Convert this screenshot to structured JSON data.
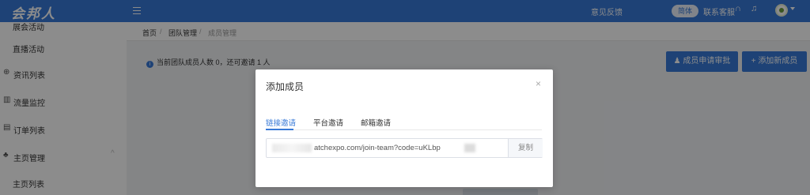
{
  "header": {
    "logo": "会邦人",
    "feedback": "意见反馈",
    "lang": "简体",
    "support": "联系客服"
  },
  "sidebar": {
    "items": [
      {
        "label": "展会活动",
        "icon": ""
      },
      {
        "label": "直播活动",
        "icon": ""
      },
      {
        "label": "资讯列表",
        "icon": "globe-icon"
      },
      {
        "label": "流量监控",
        "icon": "bar-chart-icon"
      },
      {
        "label": "订单列表",
        "icon": "clipboard-icon"
      },
      {
        "label": "主页管理",
        "icon": "sitemap-icon"
      },
      {
        "label": "主页列表",
        "icon": ""
      }
    ]
  },
  "breadcrumb": {
    "home": "首页",
    "sep": "/",
    "team": "团队管理",
    "current": "成员管理"
  },
  "notice": "当前团队成员人数 0，还可邀请 1 人",
  "buttons": {
    "approve": "成员申请审批",
    "add": "添加新成员"
  },
  "modal": {
    "title": "添加成员",
    "tabs": [
      "链接邀请",
      "平台邀请",
      "邮箱邀请"
    ],
    "link": "atchexpo.com/join-team?code=uKLbp",
    "copy": "复制"
  }
}
